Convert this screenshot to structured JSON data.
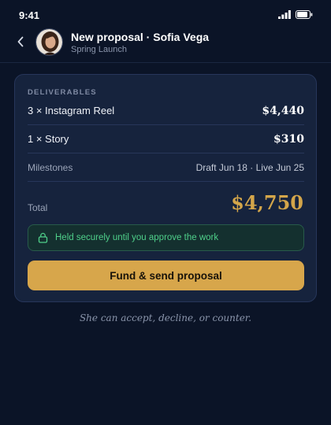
{
  "status_bar": {
    "time": "9:41",
    "signal_icon": "signal-icon",
    "battery_icon": "battery-icon"
  },
  "header": {
    "back_icon": "chevron-left-icon",
    "title": "New proposal · Sofia Vega",
    "subtitle": "Spring Launch"
  },
  "card": {
    "section_label": "DELIVERABLES",
    "deliverables": [
      {
        "label": "3 × Instagram Reel",
        "price": "$4,440"
      },
      {
        "label": "1 × Story",
        "price": "$310"
      }
    ],
    "milestones": {
      "label": "Milestones",
      "value": "Draft Jun 18 · Live Jun 25"
    },
    "total": {
      "label": "Total",
      "value": "$4,750"
    },
    "escrow_note": {
      "icon": "lock-icon",
      "text": "Held securely until you approve the work"
    },
    "fund_button": {
      "label": "Fund & send proposal"
    }
  },
  "footnote": "She can accept, decline, or counter.",
  "colors": {
    "background": "#0b1427",
    "card": "#16233d",
    "accent_gold": "#d4a64a",
    "success_green": "#4fd08a"
  }
}
